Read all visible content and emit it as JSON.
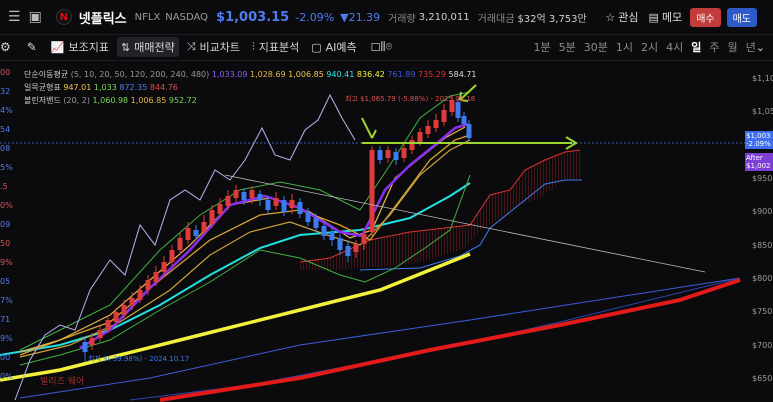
{
  "header": {
    "logo_letter": "N",
    "name": "넷플릭스",
    "ticker": "NFLX",
    "exchange": "NASDAQ",
    "price": "$1,003.15",
    "change_pct": "-2.09%",
    "change_abs": "▼21.39",
    "volume_label": "거래량",
    "volume": "3,210,011",
    "amount_label": "거래대금",
    "amount": "$32억 3,753만",
    "watch_label": "관심",
    "memo_label": "메모",
    "sell_label": "매수",
    "buy_label": "매도"
  },
  "toolbar": {
    "items": [
      "보조지표",
      "매매전략",
      "비교차트",
      "지표분석",
      "AI예측"
    ],
    "timeframes": [
      "1분",
      "5분",
      "30분",
      "1시",
      "2시",
      "4시",
      "일",
      "주",
      "월",
      "년"
    ],
    "selected_timeframe": "일"
  },
  "legend": {
    "ma_label": "단순이동평균",
    "ma_params": "(5, 10, 20, 50, 120, 200, 240, 480)",
    "ma_values": [
      "1,033.09",
      "1,028.69",
      "1,006.85",
      "940.41",
      "836.42",
      "761.89",
      "735.29",
      "584.71"
    ],
    "ma_colors": [
      "#8b5cf6",
      "#e6b84a",
      "#f0c34a",
      "#2ee6e6",
      "#f5f53b",
      "#3b5bd9",
      "#e03030",
      "#dddddd"
    ],
    "ichimoku_label": "일목균형표",
    "ichimoku_values": [
      "947.01",
      "1,033",
      "872.35",
      "844.76"
    ],
    "ichimoku_colors": [
      "#f0c34a",
      "#7ed957",
      "#4f7cf2",
      "#e05050"
    ],
    "boll_label": "볼린저밴드",
    "boll_params": "(20, 2)",
    "boll_values": [
      "1,060.98",
      "1,006.85",
      "952.72"
    ],
    "boll_colors": [
      "#7ed957",
      "#e6b84a",
      "#7ed957"
    ]
  },
  "annotations": {
    "high": "최고 $1,065.79 (-5.88%) - 2025.02.18",
    "low": "최저 $(-39.98%) - 2024.10.17",
    "watermark": "빌리즈 웨어"
  },
  "right_axis": {
    "labels": [
      "$1,100",
      "$1,050",
      "$1,000",
      "$950.00",
      "$900.00",
      "$850.00",
      "$800.00",
      "$750.00",
      "$700.00",
      "$650.00"
    ],
    "current_price": "$1,003",
    "current_change": "-2.09%",
    "after_label": "After",
    "after_price": "$1,002"
  },
  "left_axis": {
    "labels": [
      "00",
      "32",
      "4%",
      "54",
      "08",
      "5%",
      ".5",
      "0%",
      "09",
      "50",
      "9%",
      "05",
      "7%",
      "71",
      "9%",
      "00",
      "0%"
    ],
    "colors": [
      "#e05050",
      "#4f7cf2",
      "#4f7cf2",
      "#4f7cf2",
      "#4f7cf2",
      "#4f7cf2",
      "#e05050",
      "#e05050",
      "#4f7cf2",
      "#e05050",
      "#e05050",
      "#4f7cf2",
      "#4f7cf2",
      "#4f7cf2",
      "#4f7cf2",
      "#4f7cf2",
      "#4f7cf2"
    ]
  },
  "colors": {
    "up": "#e03a3a",
    "down": "#3d7bf0",
    "background": "#0b0b0d",
    "price_line": "#4f7cf2"
  }
}
